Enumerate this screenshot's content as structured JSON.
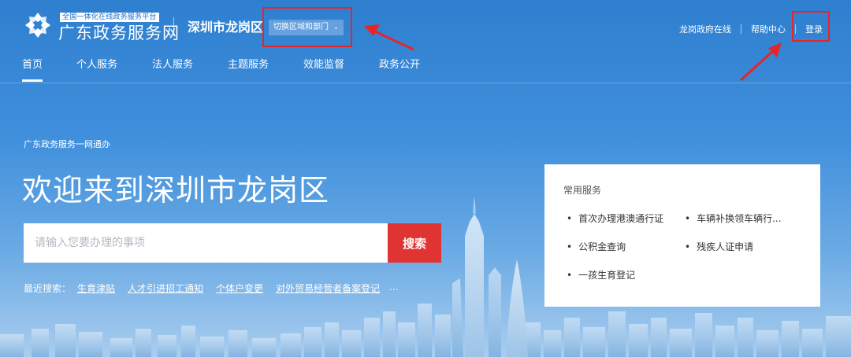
{
  "header": {
    "platform_tagline": "全国一体化在线政务服务平台",
    "brand_name": "广东政务服务网",
    "district": "深圳市龙岗区",
    "switch_label": "切换区域和部门",
    "links": {
      "gov_online": "龙岗政府在线",
      "help_center": "帮助中心",
      "login": "登录"
    }
  },
  "nav": [
    "首页",
    "个人服务",
    "法人服务",
    "主题服务",
    "效能监督",
    "政务公开"
  ],
  "hero": {
    "slogan": "广东政务服务一网通办",
    "title": "欢迎来到深圳市龙岗区",
    "search_placeholder": "请输入您要办理的事项",
    "search_button": "搜索",
    "recent_label": "最近搜索：",
    "recent_items": [
      "生育津贴",
      "人才引进招工通知",
      "个体户变更",
      "对外贸易经营者备案登记"
    ],
    "recent_more": "..."
  },
  "common_services": {
    "title": "常用服务",
    "items": [
      "首次办理港澳通行证",
      "车辆补换领车辆行...",
      "公积金查询",
      "残疾人证申请",
      "一孩生育登记"
    ]
  },
  "colors": {
    "primary": "#2f7fd0",
    "search_button": "#e03433",
    "annotation_red": "#e4262b"
  }
}
